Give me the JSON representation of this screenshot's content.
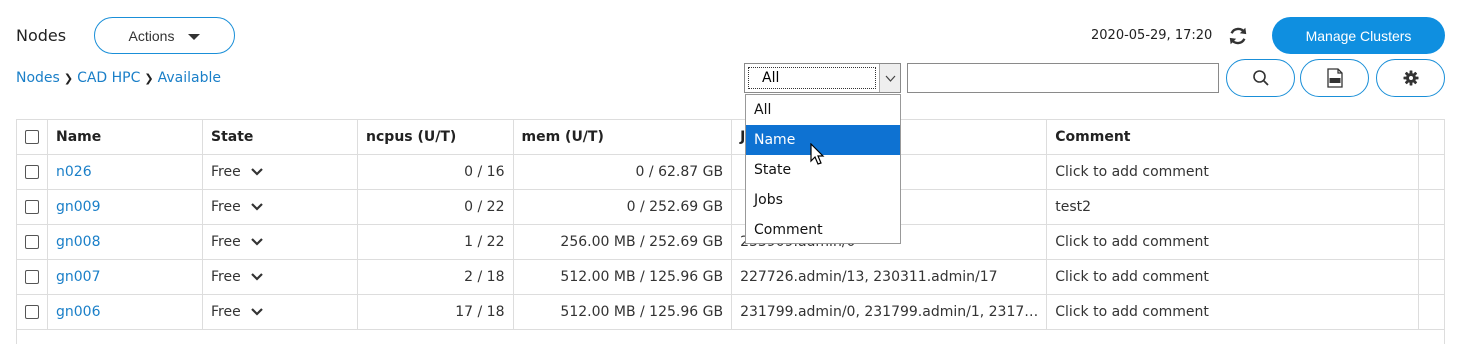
{
  "header": {
    "title": "Nodes",
    "actions_label": "Actions",
    "timestamp": "2020-05-29, 17:20",
    "manage_label": "Manage Clusters"
  },
  "breadcrumb": [
    "Nodes",
    "CAD HPC",
    "Available"
  ],
  "filter": {
    "selected": "All",
    "options": [
      "All",
      "Name",
      "State",
      "Jobs",
      "Comment"
    ],
    "highlighted": "Name",
    "search_value": ""
  },
  "table": {
    "columns": [
      "Name",
      "State",
      "ncpus (U/T)",
      "mem (U/T)",
      "Jobs",
      "Comment"
    ],
    "rows": [
      {
        "name": "n026",
        "state": "Free",
        "ncpus": "0 / 16",
        "mem": "0 / 62.87 GB",
        "jobs": "",
        "comment": "Click to add comment",
        "comment_placeholder": true
      },
      {
        "name": "gn009",
        "state": "Free",
        "ncpus": "0 / 22",
        "mem": "0 / 252.69 GB",
        "jobs": "",
        "comment": "test2",
        "comment_placeholder": false
      },
      {
        "name": "gn008",
        "state": "Free",
        "ncpus": "1 / 22",
        "mem": "256.00 MB / 252.69 GB",
        "jobs": "233909.admin/0",
        "comment": "Click to add comment",
        "comment_placeholder": true
      },
      {
        "name": "gn007",
        "state": "Free",
        "ncpus": "2 / 18",
        "mem": "512.00 MB / 125.96 GB",
        "jobs": "227726.admin/13, 230311.admin/17",
        "comment": "Click to add comment",
        "comment_placeholder": true
      },
      {
        "name": "gn006",
        "state": "Free",
        "ncpus": "17 / 18",
        "mem": "512.00 MB / 125.96 GB",
        "jobs": "231799.admin/0, 231799.admin/1, 2317…",
        "comment": "Click to add comment",
        "comment_placeholder": true
      }
    ]
  },
  "colors": {
    "accent": "#0f8fe0",
    "link": "#1a7fc8",
    "highlight": "#0e72d2"
  }
}
